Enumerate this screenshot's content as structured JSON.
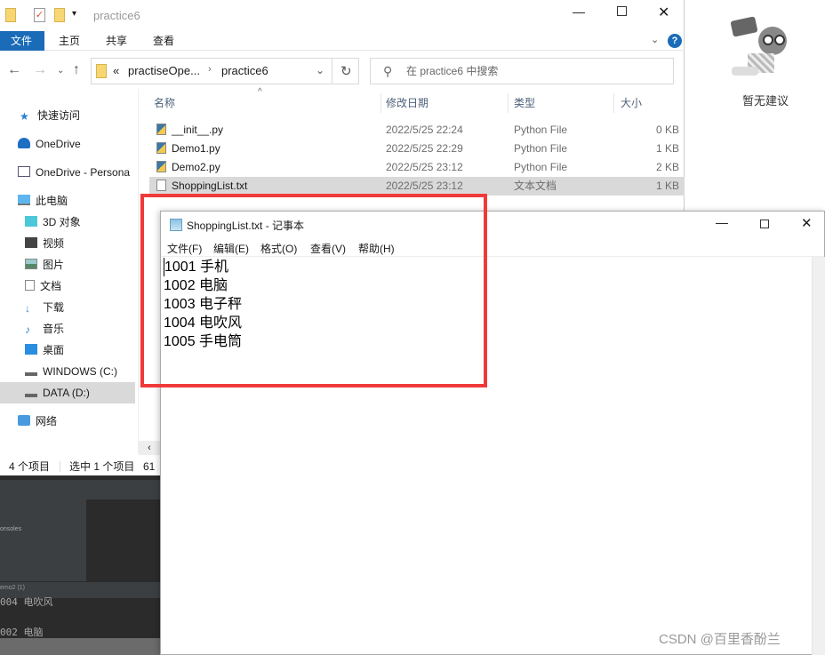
{
  "explorer": {
    "title": "practice6",
    "ribbon_tabs": [
      "文件",
      "主页",
      "共享",
      "查看"
    ],
    "breadcrumb": {
      "prefix": "«",
      "parent": "practiseOpe...",
      "current": "practice6"
    },
    "search_placeholder": "在 practice6 中搜索",
    "columns": [
      "名称",
      "修改日期",
      "类型",
      "大小"
    ],
    "files": [
      {
        "name": "__init__.py",
        "date": "2022/5/25 22:24",
        "type": "Python File",
        "size": "0 KB",
        "icon": "python-file-icon"
      },
      {
        "name": "Demo1.py",
        "date": "2022/5/25 22:29",
        "type": "Python File",
        "size": "1 KB",
        "icon": "python-file-icon"
      },
      {
        "name": "Demo2.py",
        "date": "2022/5/25 23:12",
        "type": "Python File",
        "size": "2 KB",
        "icon": "python-file-icon"
      },
      {
        "name": "ShoppingList.txt",
        "date": "2022/5/25 23:12",
        "type": "文本文档",
        "size": "1 KB",
        "icon": "text-file-icon",
        "selected": true
      }
    ],
    "sidebar": [
      "快速访问",
      "OneDrive",
      "OneDrive - Persona",
      "此电脑",
      "3D 对象",
      "视频",
      "图片",
      "文档",
      "下载",
      "音乐",
      "桌面",
      "WINDOWS (C:)",
      "DATA (D:)",
      "网络"
    ],
    "status": {
      "count": "4 个项目",
      "selected": "选中 1 个项目",
      "size": "61"
    }
  },
  "ide": {
    "consoles": "onsoles",
    "tab": "emo2 (1)",
    "lines": [
      "004 电吹风",
      "002 电脑"
    ]
  },
  "suggestion": {
    "text": "暂无建议"
  },
  "notepad": {
    "title": "ShoppingList.txt - 记事本",
    "menu": [
      "文件(F)",
      "编辑(E)",
      "格式(O)",
      "查看(V)",
      "帮助(H)"
    ],
    "lines": [
      "1001 手机",
      "1002 电脑",
      "1003 电子秤",
      "1004 电吹风",
      "1005 手电筒"
    ]
  },
  "watermark": "CSDN @百里香酚兰",
  "colors": {
    "highlight": "#f03a3a",
    "ribbon_active": "#1a6bb8"
  }
}
